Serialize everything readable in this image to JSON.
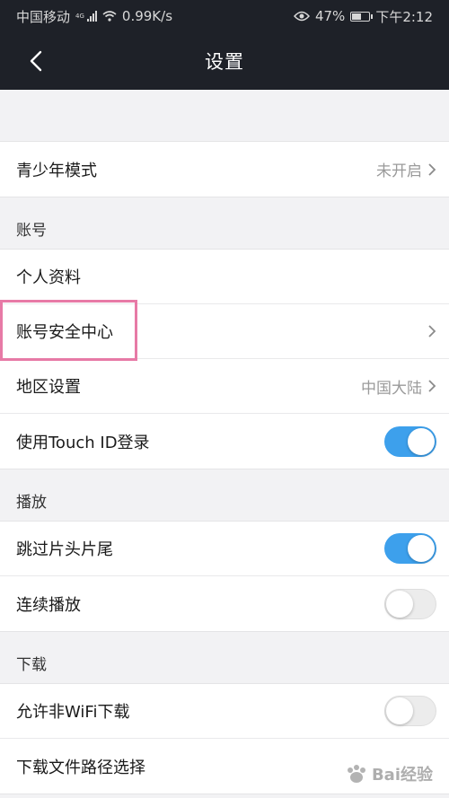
{
  "status_bar": {
    "carrier": "中国移动",
    "network": "4G",
    "speed": "0.99K/s",
    "battery": "47%",
    "time": "下午2:12"
  },
  "nav": {
    "title": "设置"
  },
  "rows": {
    "teen_mode": {
      "label": "青少年模式",
      "value": "未开启"
    },
    "profile": {
      "label": "个人资料"
    },
    "security": {
      "label": "账号安全中心"
    },
    "region": {
      "label": "地区设置",
      "value": "中国大陆"
    },
    "touch_id": {
      "label": "使用Touch ID登录",
      "toggle": "on"
    },
    "skip_intro": {
      "label": "跳过片头片尾",
      "toggle": "on"
    },
    "autoplay": {
      "label": "连续播放",
      "toggle": "off"
    },
    "non_wifi": {
      "label": "允许非WiFi下载",
      "toggle": "off"
    },
    "download_path": {
      "label": "下载文件路径选择"
    }
  },
  "sections": {
    "account": "账号",
    "playback": "播放",
    "download": "下载"
  },
  "colors": {
    "accent": "#3da0ec",
    "nav_bg": "#1e2128",
    "highlight": "#e77aa6"
  },
  "watermark": {
    "text": "Bai经验"
  }
}
